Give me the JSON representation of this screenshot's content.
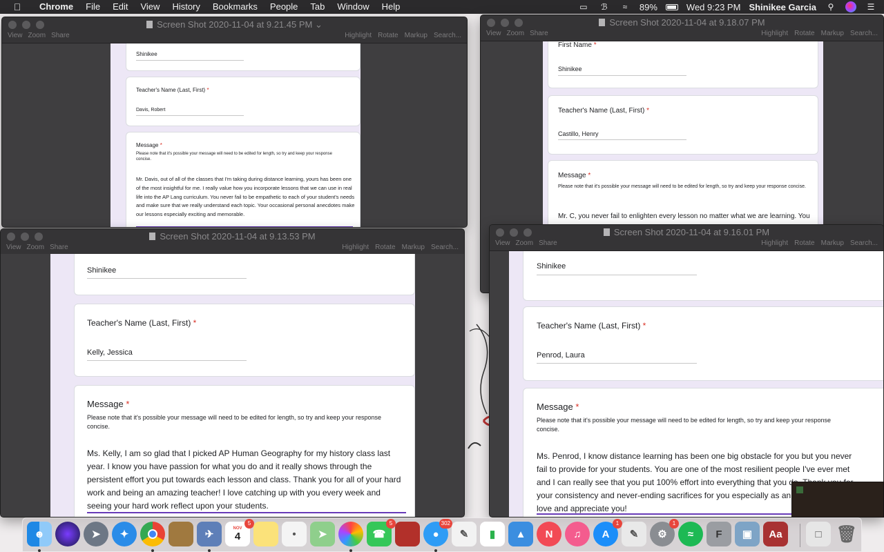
{
  "menubar": {
    "app_name": "Chrome",
    "menus": [
      "File",
      "Edit",
      "View",
      "History",
      "Bookmarks",
      "People",
      "Tab",
      "Window",
      "Help"
    ],
    "battery": "89%",
    "datetime": "Wed 9:23 PM",
    "user": "Shinikee Garcia"
  },
  "toolbar": {
    "view": "View",
    "zoom": "Zoom",
    "share": "Share",
    "highlight": "Highlight",
    "rotate": "Rotate",
    "markup": "Markup",
    "search": "Search..."
  },
  "form_labels": {
    "teacher": "Teacher's Name (Last, First)",
    "message": "Message",
    "first_name": "First Name",
    "required_mark": "*",
    "note": "Please note that it's possible your message will need to be edited for length, so try and keep your response concise."
  },
  "windows": [
    {
      "title": "Screen Shot 2020-11-04 at 9.21.45 PM",
      "first_name": "Shinikee",
      "teacher": "Davis, Robert",
      "message": "Mr. Davis, out of all of the classes that I'm taking during distance learning, yours has been one of the most insightful for me. I really value how you incorporate lessons that we can use in real life into the AP Lang curriculum. You never fail to be empathetic to each of your student's needs and make sure that we really understand each topic. Your occasional personal anecdotes make our lessons especially exciting and memorable."
    },
    {
      "title": "Screen Shot 2020-11-04 at 9.18.07 PM",
      "first_name": "Shinikee",
      "teacher": "Castillo, Henry",
      "message": "Mr. C, you never fail to enlighten every lesson no matter what we are learning. You"
    },
    {
      "title": "Screen Shot 2020-11-04 at 9.13.53 PM",
      "first_name": "Shinikee",
      "teacher": "Kelly, Jessica",
      "message": "Ms. Kelly, I am so glad that I picked AP Human Geography for my history class last year. I know you have passion for what you do and it really shows through the persistent effort you put towards each lesson and class. Thank you for all of your hard work and being an amazing teacher! I love catching up with you every week and seeing your hard work reflect upon your students."
    },
    {
      "title": "Screen Shot 2020-11-04 at 9.16.01 PM",
      "first_name": "Shinikee",
      "teacher": "Penrod, Laura",
      "message": "Ms. Penrod, I know distance learning has been one big obstacle for you but you never fail to provide for your students. You are one of the most resilient people I've ever met and I can really see that you put 100% effort into everything that you do. Thank you for your consistency and never-ending sacrifices for you especially as an NHS advisor. We love and appreciate you!"
    }
  ],
  "dock": {
    "calendar_month": "NOV",
    "calendar_day": "4",
    "badges": {
      "calendar": "5",
      "facetime": "5",
      "messages": "302",
      "appstore": "1",
      "prefs": "1"
    }
  }
}
